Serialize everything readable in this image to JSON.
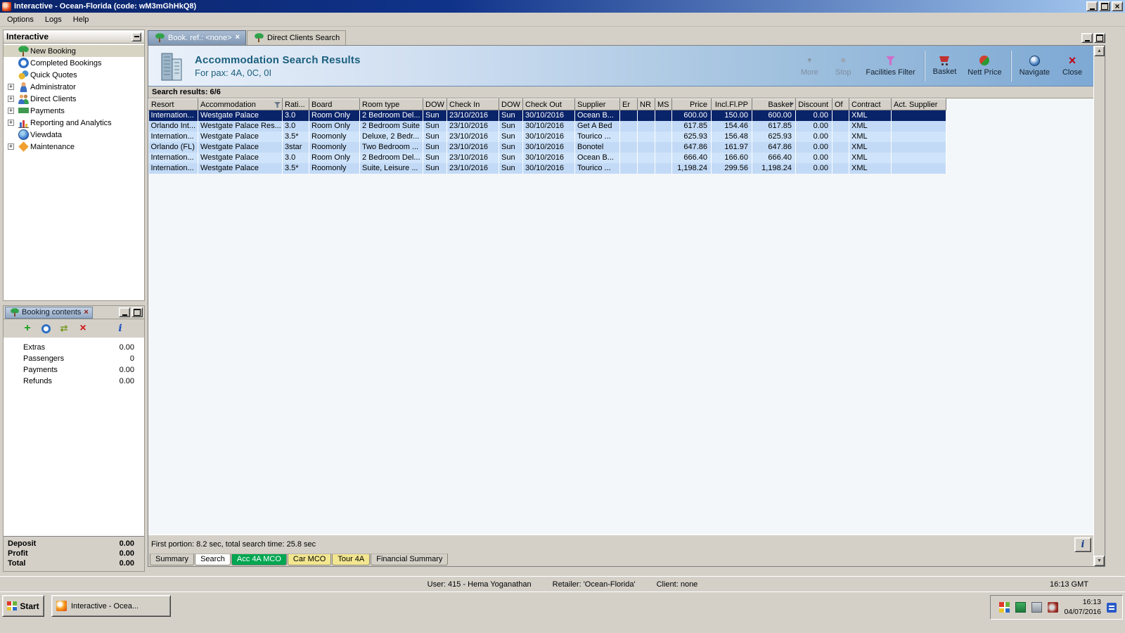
{
  "window": {
    "title": "Interactive - Ocean-Florida (code: wM3mGhHkQ8)"
  },
  "menu_bar": {
    "items": [
      "Options",
      "Logs",
      "Help"
    ]
  },
  "sidebar": {
    "title": "Interactive",
    "items": [
      {
        "label": "New Booking",
        "icon": "palm-icon",
        "expandable": false,
        "selected": true
      },
      {
        "label": "Completed Bookings",
        "icon": "clock-icon",
        "expandable": false,
        "selected": false
      },
      {
        "label": "Quick Quotes",
        "icon": "quotes-icon",
        "expandable": false,
        "selected": false
      },
      {
        "label": "Administrator",
        "icon": "admin-person-icon",
        "expandable": true,
        "selected": false
      },
      {
        "label": "Direct Clients",
        "icon": "clients-icon",
        "expandable": true,
        "selected": false
      },
      {
        "label": "Payments",
        "icon": "payments-icon",
        "expandable": true,
        "selected": false
      },
      {
        "label": "Reporting and Analytics",
        "icon": "chart-icon",
        "expandable": true,
        "selected": false
      },
      {
        "label": "Viewdata",
        "icon": "globe-icon",
        "expandable": false,
        "selected": false
      },
      {
        "label": "Maintenance",
        "icon": "maintenance-icon",
        "expandable": true,
        "selected": false
      }
    ]
  },
  "booking_contents": {
    "title": "Booking contents",
    "toolbar_icons": [
      "add-icon",
      "clock-icon",
      "transfer-icon",
      "delete-icon",
      "palm-transfer-icon",
      "info-icon"
    ],
    "rows": [
      {
        "label": "Extras",
        "value": "0.00"
      },
      {
        "label": "Passengers",
        "value": "0"
      },
      {
        "label": "Payments",
        "value": "0.00"
      },
      {
        "label": "Refunds",
        "value": "0.00"
      }
    ],
    "totals": [
      {
        "label": "Deposit",
        "value": "0.00"
      },
      {
        "label": "Profit",
        "value": "0.00"
      },
      {
        "label": "Total",
        "value": "0.00"
      }
    ]
  },
  "document_tabs": [
    {
      "label": "Book. ref.: <none>",
      "active": true
    },
    {
      "label": "Direct Clients Search",
      "active": false
    }
  ],
  "search_header": {
    "title": "Accommodation Search Results",
    "subtitle": "For pax: 4A, 0C, 0I"
  },
  "toolbar": {
    "buttons": [
      {
        "label": "More",
        "icon": "more-icon",
        "disabled": true
      },
      {
        "label": "Stop",
        "icon": "stop-icon",
        "disabled": true
      },
      {
        "label": "Facilities Filter",
        "icon": "filter-icon",
        "disabled": false
      },
      {
        "label": "Basket",
        "icon": "basket-icon",
        "disabled": false
      },
      {
        "label": "Nett Price",
        "icon": "nett-price-icon",
        "disabled": false
      },
      {
        "label": "Navigate",
        "icon": "navigate-icon",
        "disabled": false
      },
      {
        "label": "Close",
        "icon": "close-red-icon",
        "disabled": false
      }
    ]
  },
  "results": {
    "summary": "Search results: 6/6",
    "columns": [
      "Resort",
      "Accommodation",
      "Rati...",
      "Board",
      "Room type",
      "DOW",
      "Check In",
      "DOW",
      "Check Out",
      "Supplier",
      "Er",
      "NR",
      "MS",
      "Price",
      "Incl.Fl.PP",
      "Basket",
      "Discount",
      "Of",
      "Contract",
      "Act. Supplier"
    ],
    "selected_row": 0,
    "rows": [
      [
        "Internation...",
        "Westgate Palace",
        "3.0",
        "Room Only",
        "2 Bedroom Del...",
        "Sun",
        "23/10/2016",
        "Sun",
        "30/10/2016",
        "Ocean B...",
        "",
        "",
        "",
        "600.00",
        "150.00",
        "600.00",
        "0.00",
        "",
        "XML",
        ""
      ],
      [
        "Orlando Int...",
        "Westgate Palace Res...",
        "3.0",
        "Room Only",
        "2 Bedroom Suite",
        "Sun",
        "23/10/2016",
        "Sun",
        "30/10/2016",
        "Get A Bed",
        "",
        "",
        "",
        "617.85",
        "154.46",
        "617.85",
        "0.00",
        "",
        "XML",
        ""
      ],
      [
        "Internation...",
        "Westgate Palace",
        "3.5*",
        "Roomonly",
        "Deluxe, 2 Bedr...",
        "Sun",
        "23/10/2016",
        "Sun",
        "30/10/2016",
        "Tourico ...",
        "",
        "",
        "",
        "625.93",
        "156.48",
        "625.93",
        "0.00",
        "",
        "XML",
        ""
      ],
      [
        "Orlando (FL)",
        "Westgate Palace",
        "3star",
        "Roomonly",
        "Two Bedroom ...",
        "Sun",
        "23/10/2016",
        "Sun",
        "30/10/2016",
        "Bonotel",
        "",
        "",
        "",
        "647.86",
        "161.97",
        "647.86",
        "0.00",
        "",
        "XML",
        ""
      ],
      [
        "Internation...",
        "Westgate Palace",
        "3.0",
        "Room Only",
        "2 Bedroom Del...",
        "Sun",
        "23/10/2016",
        "Sun",
        "30/10/2016",
        "Ocean B...",
        "",
        "",
        "",
        "666.40",
        "166.60",
        "666.40",
        "0.00",
        "",
        "XML",
        ""
      ],
      [
        "Internation...",
        "Westgate Palace",
        "3.5*",
        "Roomonly",
        "Suite, Leisure ...",
        "Sun",
        "23/10/2016",
        "Sun",
        "30/10/2016",
        "Tourico ...",
        "",
        "",
        "",
        "1,198.24",
        "299.56",
        "1,198.24",
        "0.00",
        "",
        "XML",
        ""
      ]
    ]
  },
  "status_row": {
    "text": "First portion: 8.2 sec, total search time: 25.8 sec"
  },
  "page_tabs": [
    {
      "label": "Summary",
      "style": "default"
    },
    {
      "label": "Search",
      "style": "active"
    },
    {
      "label": "Acc 4A MCO",
      "style": "green"
    },
    {
      "label": "Car MCO",
      "style": "yellow"
    },
    {
      "label": "Tour 4A",
      "style": "yellow"
    },
    {
      "label": "Financial Summary",
      "style": "default"
    }
  ],
  "status_bar": {
    "user": "User: 415 - Hema Yoganathan",
    "retailer": "Retailer: 'Ocean-Florida'",
    "client": "Client: none",
    "time": "16:13 GMT"
  },
  "taskbar": {
    "start_label": "Start",
    "task_button": "Interactive - Ocea...",
    "tray_time": "16:13",
    "tray_date": "04/07/2016"
  },
  "colors": {
    "selected_row_bg": "#0a246a",
    "row_bg": "#cfe4fa",
    "header_title": "#1b5f7e",
    "tab_green": "#00a651",
    "tab_yellow": "#f2e690"
  }
}
